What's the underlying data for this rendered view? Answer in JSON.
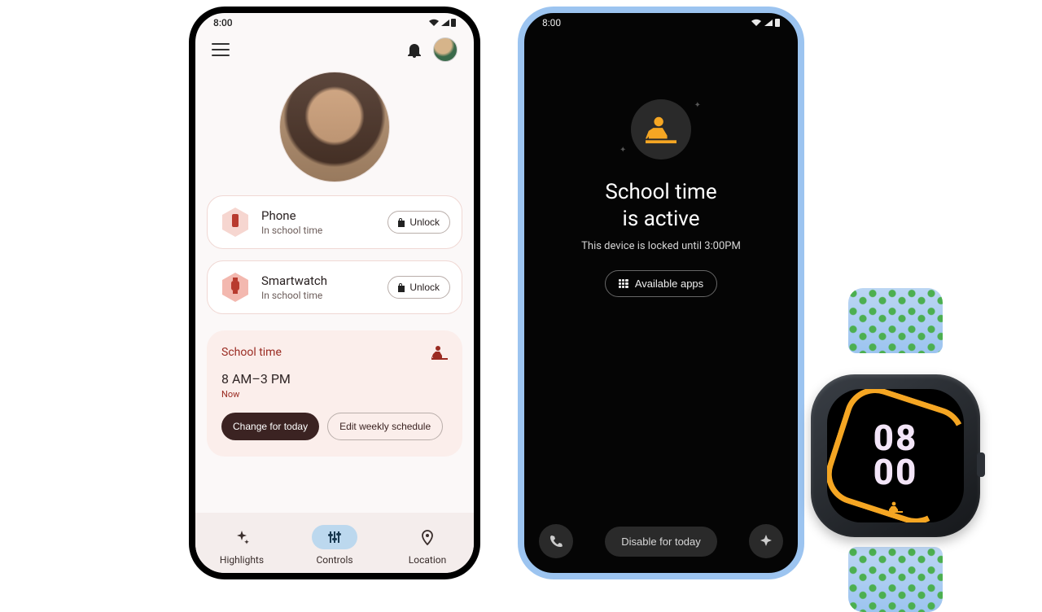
{
  "phone1": {
    "status_time": "8:00",
    "devices": [
      {
        "name": "Phone",
        "status": "In school time",
        "action": "Unlock"
      },
      {
        "name": "Smartwatch",
        "status": "In school time",
        "action": "Unlock"
      }
    ],
    "schedule": {
      "title": "School time",
      "range": "8 AM–3 PM",
      "now_label": "Now",
      "change_btn": "Change for today",
      "edit_btn": "Edit weekly schedule"
    },
    "nav": {
      "highlights": "Highlights",
      "controls": "Controls",
      "location": "Location"
    }
  },
  "phone2": {
    "status_time": "8:00",
    "title_line1": "School time",
    "title_line2": "is active",
    "subtitle": "This device is locked until 3:00PM",
    "available_btn": "Available apps",
    "disable_btn": "Disable for today"
  },
  "watch": {
    "hours": "08",
    "minutes": "00"
  }
}
